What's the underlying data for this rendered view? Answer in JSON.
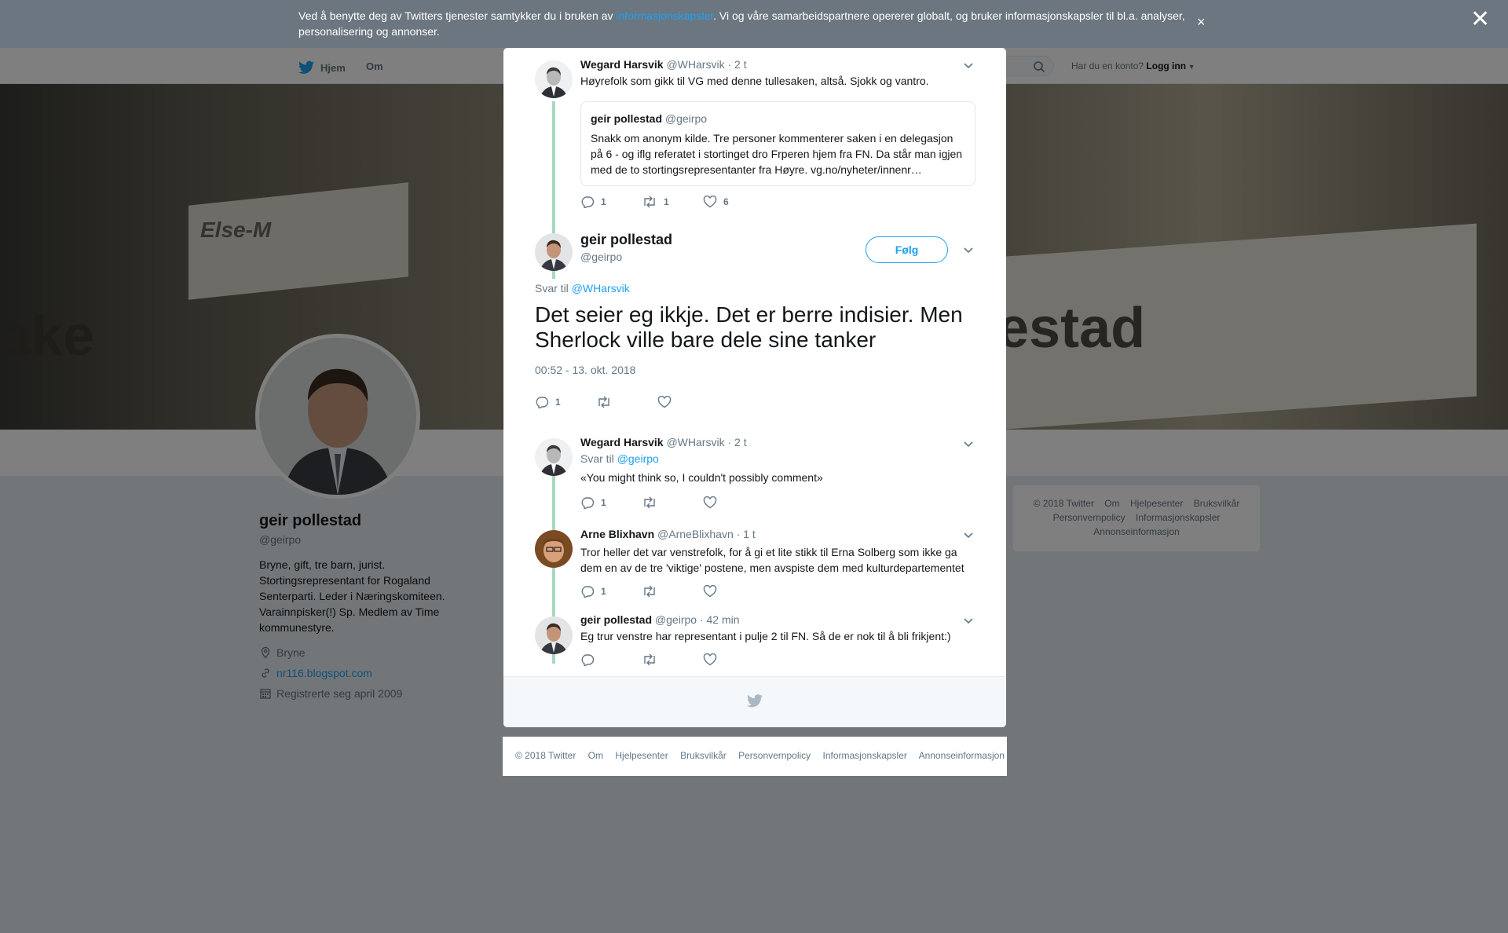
{
  "cookie_banner": {
    "text_before": "Ved å benytte deg av Twitters tjenester samtykker du i bruken av ",
    "link": "informasjonskapsler",
    "text_after": ". Vi og våre samarbeidspartnere opererer globalt, og bruker informasjonskapsler til bl.a. analyser, personalisering og annonser.",
    "close": "×"
  },
  "overlay_close": "✕",
  "topnav": {
    "home": "Hjem",
    "about": "Om",
    "account_prompt": "Har du en konto?",
    "login": "Logg inn"
  },
  "header_photo": {
    "sign_left": "ake",
    "sign_left_name": "Else-M",
    "sign_right": "estad"
  },
  "profile": {
    "name": "geir pollestad",
    "handle": "@geirpo",
    "bio": "Bryne, gift, tre barn, jurist. Stortingsrepresentant for Rogaland Senterparti. Leder i Næringskomiteen. Varainnpisker(!) Sp. Medlem av Time kommunestyre.",
    "location": "Bryne",
    "website": "nr116.blogspot.com",
    "joined": "Registrerte seg april 2009"
  },
  "side_footer": {
    "items": [
      "© 2018 Twitter",
      "Om",
      "Hjelpesenter",
      "Bruksvilkår",
      "Personvernpolicy",
      "Informasjonskapsler",
      "Annonseinformasjon"
    ]
  },
  "modal": {
    "tweet1": {
      "name": "Wegard Harsvik",
      "handle": "@WHarsvik",
      "time": "· 2 t",
      "text": "Høyrefolk som gikk til VG med denne tullesaken, altså. Sjokk og vantro.",
      "quote": {
        "name": "geir pollestad",
        "handle": "@geirpo",
        "text": "Snakk om anonym kilde. Tre personer kommenterer saken i en delegasjon på 6 - og iflg referatet i stortinget dro Frperen hjem fra FN. Da står man igjen med de to stortingsrepresentanter fra Høyre. vg.no/nyheter/innenr…"
      },
      "replies": "1",
      "retweets": "1",
      "likes": "6"
    },
    "main": {
      "name": "geir pollestad",
      "handle": "@geirpo",
      "follow": "Følg",
      "reply_prefix": "Svar til ",
      "reply_to": "@WHarsvik",
      "text": "Det seier eg ikkje. Det er berre indisier. Men Sherlock ville bare dele sine tanker",
      "timestamp": "00:52 - 13. okt. 2018",
      "replies": "1"
    },
    "reply1": {
      "name": "Wegard Harsvik",
      "handle": "@WHarsvik",
      "time": "· 2 t",
      "reply_prefix": "Svar til ",
      "reply_to": "@geirpo",
      "text": "«You might think so, I couldn't possibly comment»",
      "replies": "1"
    },
    "reply2": {
      "name": "Arne Blixhavn",
      "handle": "@ArneBlixhavn",
      "time": "· 1 t",
      "text": "Tror heller det var venstrefolk, for å gi et lite stikk til Erna Solberg som ikke ga dem en av de tre 'viktige' postene, men avspiste dem med kulturdepartementet",
      "replies": "1"
    },
    "reply3": {
      "name": "geir pollestad",
      "handle": "@geirpo",
      "time": "· 42 min",
      "text": "Eg trur venstre har representant i pulje 2 til FN. Så de er nok til å bli frikjent:)"
    }
  },
  "bottom_footer": {
    "items": [
      "© 2018 Twitter",
      "Om",
      "Hjelpesenter",
      "Bruksvilkår",
      "Personvernpolicy",
      "Informasjonskapsler",
      "Annonseinformasjon"
    ]
  },
  "colors": {
    "accent": "#1da1f2",
    "thread_line": "#a6d9bd",
    "text": "#14171a",
    "muted": "#657786"
  }
}
